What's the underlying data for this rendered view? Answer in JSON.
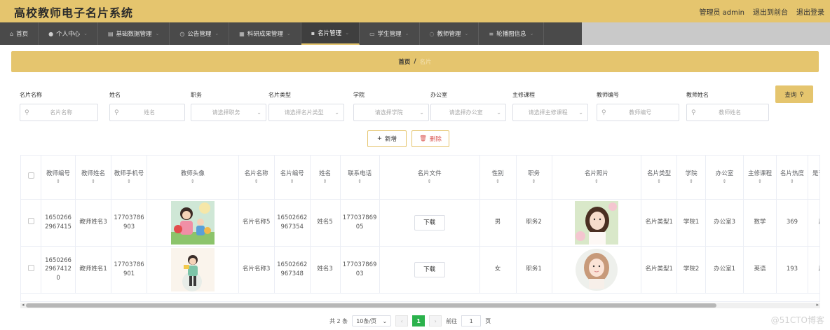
{
  "app": {
    "title": "高校教师电子名片系统"
  },
  "top_right": {
    "user": "管理员 admin",
    "front": "退出到前台",
    "logout": "退出登录"
  },
  "nav": [
    {
      "icon": "home-icon",
      "glyph": "⌂",
      "label": "首页",
      "chev": false
    },
    {
      "icon": "user-icon",
      "glyph": "●",
      "label": "个人中心",
      "chev": true
    },
    {
      "icon": "database-icon",
      "glyph": "▤",
      "label": "基础数据管理",
      "chev": true
    },
    {
      "icon": "clock-icon",
      "glyph": "◷",
      "label": "公告管理",
      "chev": true
    },
    {
      "icon": "document-icon",
      "glyph": "▦",
      "label": "科研成果管理",
      "chev": true
    },
    {
      "icon": "grid-icon",
      "glyph": "▪",
      "label": "名片管理",
      "chev": true,
      "active": true
    },
    {
      "icon": "card-icon",
      "glyph": "▭",
      "label": "学生管理",
      "chev": true
    },
    {
      "icon": "power-icon",
      "glyph": "◌",
      "label": "教师管理",
      "chev": true
    },
    {
      "icon": "menu-icon",
      "glyph": "≡",
      "label": "轮播图信息",
      "chev": true
    }
  ],
  "breadcrumb": {
    "home": "首页",
    "sep": "/",
    "current": "名片"
  },
  "filters": [
    {
      "label": "名片名称",
      "placeholder": "名片名称",
      "type": "input"
    },
    {
      "label": "姓名",
      "placeholder": "姓名",
      "type": "input"
    },
    {
      "label": "职务",
      "placeholder": "请选择职务",
      "type": "select"
    },
    {
      "label": "名片类型",
      "placeholder": "请选择名片类型",
      "type": "select"
    },
    {
      "label": "学院",
      "placeholder": "请选择学院",
      "type": "select"
    },
    {
      "label": "办公室",
      "placeholder": "请选择办公室",
      "type": "select"
    },
    {
      "label": "主修课程",
      "placeholder": "请选择主修课程",
      "type": "select"
    },
    {
      "label": "教师编号",
      "placeholder": "教师编号",
      "type": "input"
    },
    {
      "label": "教师姓名",
      "placeholder": "教师姓名",
      "type": "input"
    }
  ],
  "buttons": {
    "search": "查询",
    "add": "新增",
    "delete": "删除"
  },
  "table": {
    "headers": [
      "教师编号",
      "教师姓名",
      "教师手机号",
      "教师头像",
      "名片名称",
      "名片编号",
      "姓名",
      "联系电话",
      "名片文件",
      "性别",
      "职务",
      "名片照片",
      "名片类型",
      "学院",
      "办公室",
      "主修课程",
      "名片热度",
      "是否展示"
    ],
    "rows": [
      {
        "teacher_no": "16502662967415",
        "teacher_name": "教师姓名3",
        "teacher_phone": "17703786903",
        "card_name": "名片名称5",
        "card_no": "16502662967354",
        "name": "姓名5",
        "phone": "17703786905",
        "file": "下载",
        "gender": "男",
        "post": "职务2",
        "card_type": "名片类型1",
        "college": "学院1",
        "office": "办公室3",
        "course": "数学",
        "heat": "369",
        "show": "展示"
      },
      {
        "teacher_no": "16502662967412 0",
        "teacher_name": "教师姓名1",
        "teacher_phone": "17703786901",
        "card_name": "名片名称3",
        "card_no": "16502662967348",
        "name": "姓名3",
        "phone": "17703786903",
        "file": "下载",
        "gender": "女",
        "post": "职务1",
        "card_type": "名片类型1",
        "college": "学院2",
        "office": "办公室1",
        "course": "英语",
        "heat": "193",
        "show": "展示"
      }
    ]
  },
  "pager": {
    "total": "共 2 条",
    "size": "10条/页",
    "page": "1",
    "goto": "前往",
    "goto_val": "1",
    "unit": "页"
  },
  "watermark": "@51CTO博客",
  "colors": {
    "accent": "#e5c56e",
    "nav_bg": "#4a4a4a",
    "page_active": "#2bb24c"
  }
}
